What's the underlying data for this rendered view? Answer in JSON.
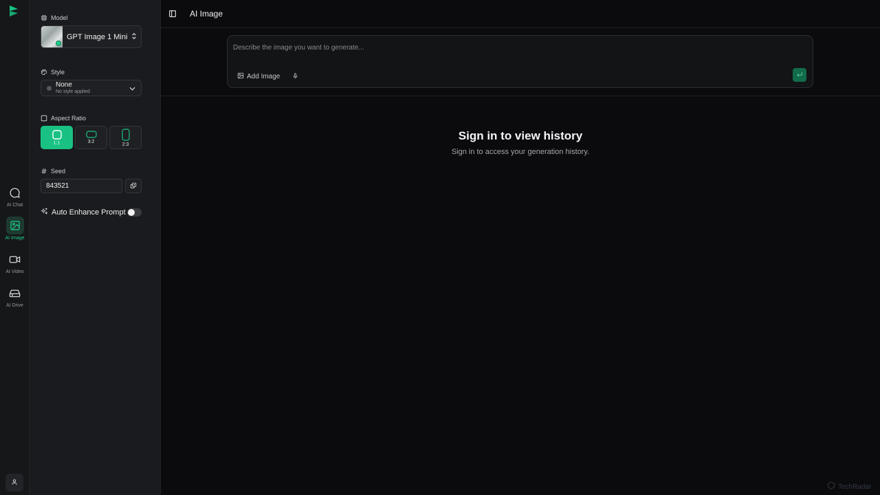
{
  "app": {
    "title": "AI Image",
    "brand_color": "#19c283"
  },
  "rail": {
    "items": [
      {
        "label": "AI Chat",
        "icon": "chat-bubble-icon",
        "active": false
      },
      {
        "label": "AI Image",
        "icon": "image-icon",
        "active": true
      },
      {
        "label": "AI Video",
        "icon": "video-camera-icon",
        "active": false
      },
      {
        "label": "AI Drive",
        "icon": "drive-icon",
        "active": false
      }
    ],
    "user_icon": "user-icon"
  },
  "settings": {
    "model": {
      "label": "Model",
      "value": "GPT Image 1 Mini"
    },
    "style": {
      "label": "Style",
      "value": "None",
      "description": "No style applied"
    },
    "aspect_ratio": {
      "label": "Aspect Ratio",
      "options": [
        "1:1",
        "3:2",
        "2:3"
      ],
      "selected": "1:1"
    },
    "seed": {
      "label": "Seed",
      "value": "843521"
    },
    "auto_enhance": {
      "label": "Auto Enhance Prompt",
      "enabled": false
    }
  },
  "composer": {
    "placeholder": "Describe the image you want to generate...",
    "add_image_label": "Add Image"
  },
  "history": {
    "title": "Sign in to view history",
    "subtitle": "Sign in to access your generation history."
  },
  "watermark": {
    "text": "TechRadar"
  }
}
